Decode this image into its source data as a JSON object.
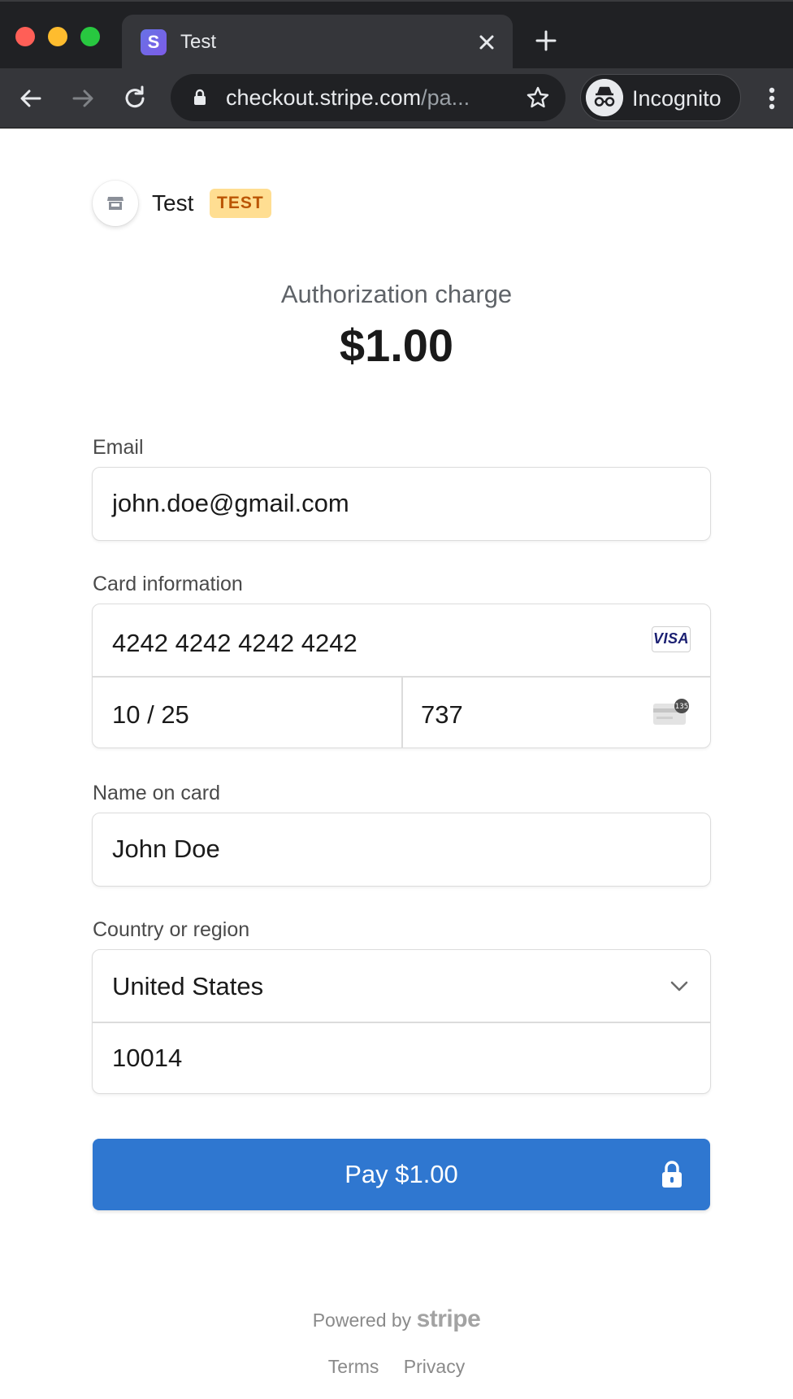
{
  "browser": {
    "tab_title": "Test",
    "tab_favicon_letter": "S",
    "url_host": "checkout.stripe.com",
    "url_path": "/pa...",
    "incognito_label": "Incognito"
  },
  "merchant": {
    "name": "Test",
    "badge": "TEST"
  },
  "summary": {
    "label": "Authorization charge",
    "amount": "$1.00"
  },
  "form": {
    "email_label": "Email",
    "email_value": "john.doe@gmail.com",
    "card_label": "Card information",
    "card_number": "4242 4242 4242 4242",
    "card_brand": "VISA",
    "card_expiry": "10 / 25",
    "card_cvc": "737",
    "cvc_hint": "135",
    "name_label": "Name on card",
    "name_value": "John Doe",
    "country_label": "Country or region",
    "country_value": "United States",
    "zip_value": "10014"
  },
  "pay_button": {
    "label": "Pay $1.00"
  },
  "footer": {
    "powered_by": "Powered by",
    "brand": "stripe",
    "terms": "Terms",
    "privacy": "Privacy"
  },
  "colors": {
    "pay_button": "#2f77d0",
    "test_badge_bg": "#ffde92",
    "test_badge_text": "#bb5504",
    "chrome_dark": "#202124"
  }
}
